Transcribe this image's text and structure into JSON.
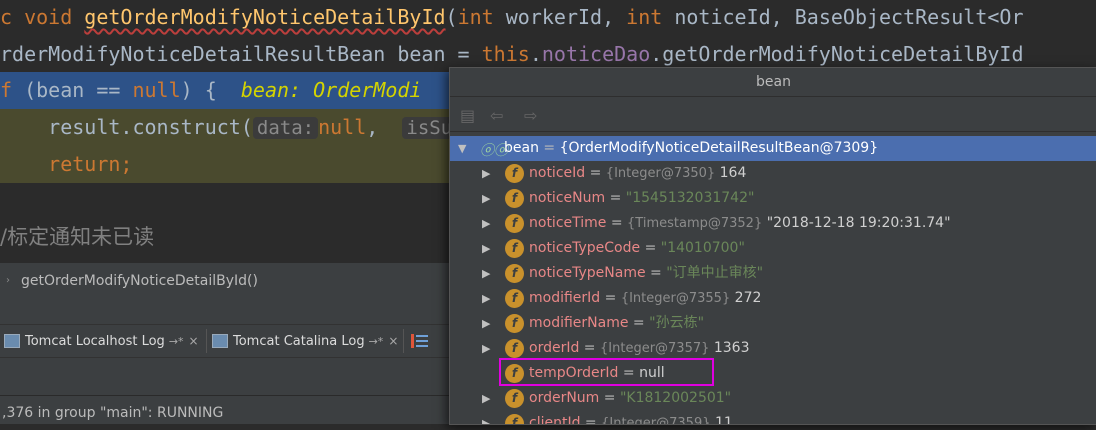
{
  "editor": {
    "lines": [
      {
        "kw1": "c void ",
        "method": "getOrderModifyNoticeDetailById",
        "p1": "(",
        "kw2": "int",
        "p2": " workerId, ",
        "kw3": "int",
        "p3": " noticeId, BaseObjectResult<Or"
      },
      {
        "p1": "rderModifyNoticeDetailResultBean bean = ",
        "kw1": "this",
        "p2": ".",
        "field": "noticeDao",
        "p3": ".getOrderModifyNoticeDetailById"
      },
      {
        "kw1": "f",
        "p1": " (bean == ",
        "kw2": "null",
        "p2": ") {  ",
        "inline": "bean: OrderModi"
      },
      {
        "p1": "    result.construct(",
        "hint1": "data:",
        "kw1": "null",
        "p2": ",  ",
        "hint2": "isSu"
      },
      {
        "kw1": "    return;"
      },
      {
        "comment": "/标定通知未已读"
      }
    ]
  },
  "frames": {
    "current": "getOrderModifyNoticeDetailById()"
  },
  "tabs": [
    {
      "label": "Tomcat Localhost Log",
      "pin": "→*",
      "close": "×"
    },
    {
      "label": "Tomcat Catalina Log",
      "pin": "→*",
      "close": "×"
    }
  ],
  "status": {
    "text": ",376 in group \"main\": RUNNING"
  },
  "popup": {
    "title": "bean",
    "root": {
      "name": "bean",
      "value": "{OrderModifyNoticeDetailResultBean@7309}"
    },
    "fields": [
      {
        "name": "noticeId",
        "type": "{Integer@7350}",
        "value": "164",
        "is_string": false
      },
      {
        "name": "noticeNum",
        "type": "",
        "value": "\"1545132031742\"",
        "is_string": true
      },
      {
        "name": "noticeTime",
        "type": "{Timestamp@7352}",
        "value": "\"2018-12-18 19:20:31.74\"",
        "is_string": false
      },
      {
        "name": "noticeTypeCode",
        "type": "",
        "value": "\"14010700\"",
        "is_string": true
      },
      {
        "name": "noticeTypeName",
        "type": "",
        "value": "\"订单中止审核\"",
        "is_string": true
      },
      {
        "name": "modifierId",
        "type": "{Integer@7355}",
        "value": "272",
        "is_string": false
      },
      {
        "name": "modifierName",
        "type": "",
        "value": "\"孙云栋\"",
        "is_string": true
      },
      {
        "name": "orderId",
        "type": "{Integer@7357}",
        "value": "1363",
        "is_string": false
      },
      {
        "name": "tempOrderId",
        "type": "",
        "value": "null",
        "is_string": false
      },
      {
        "name": "orderNum",
        "type": "",
        "value": "\"K1812002501\"",
        "is_string": true
      },
      {
        "name": "clientId",
        "type": "{Integer@7359}",
        "value": "11",
        "is_string": false
      }
    ],
    "highlight_color": "#e000e0"
  }
}
